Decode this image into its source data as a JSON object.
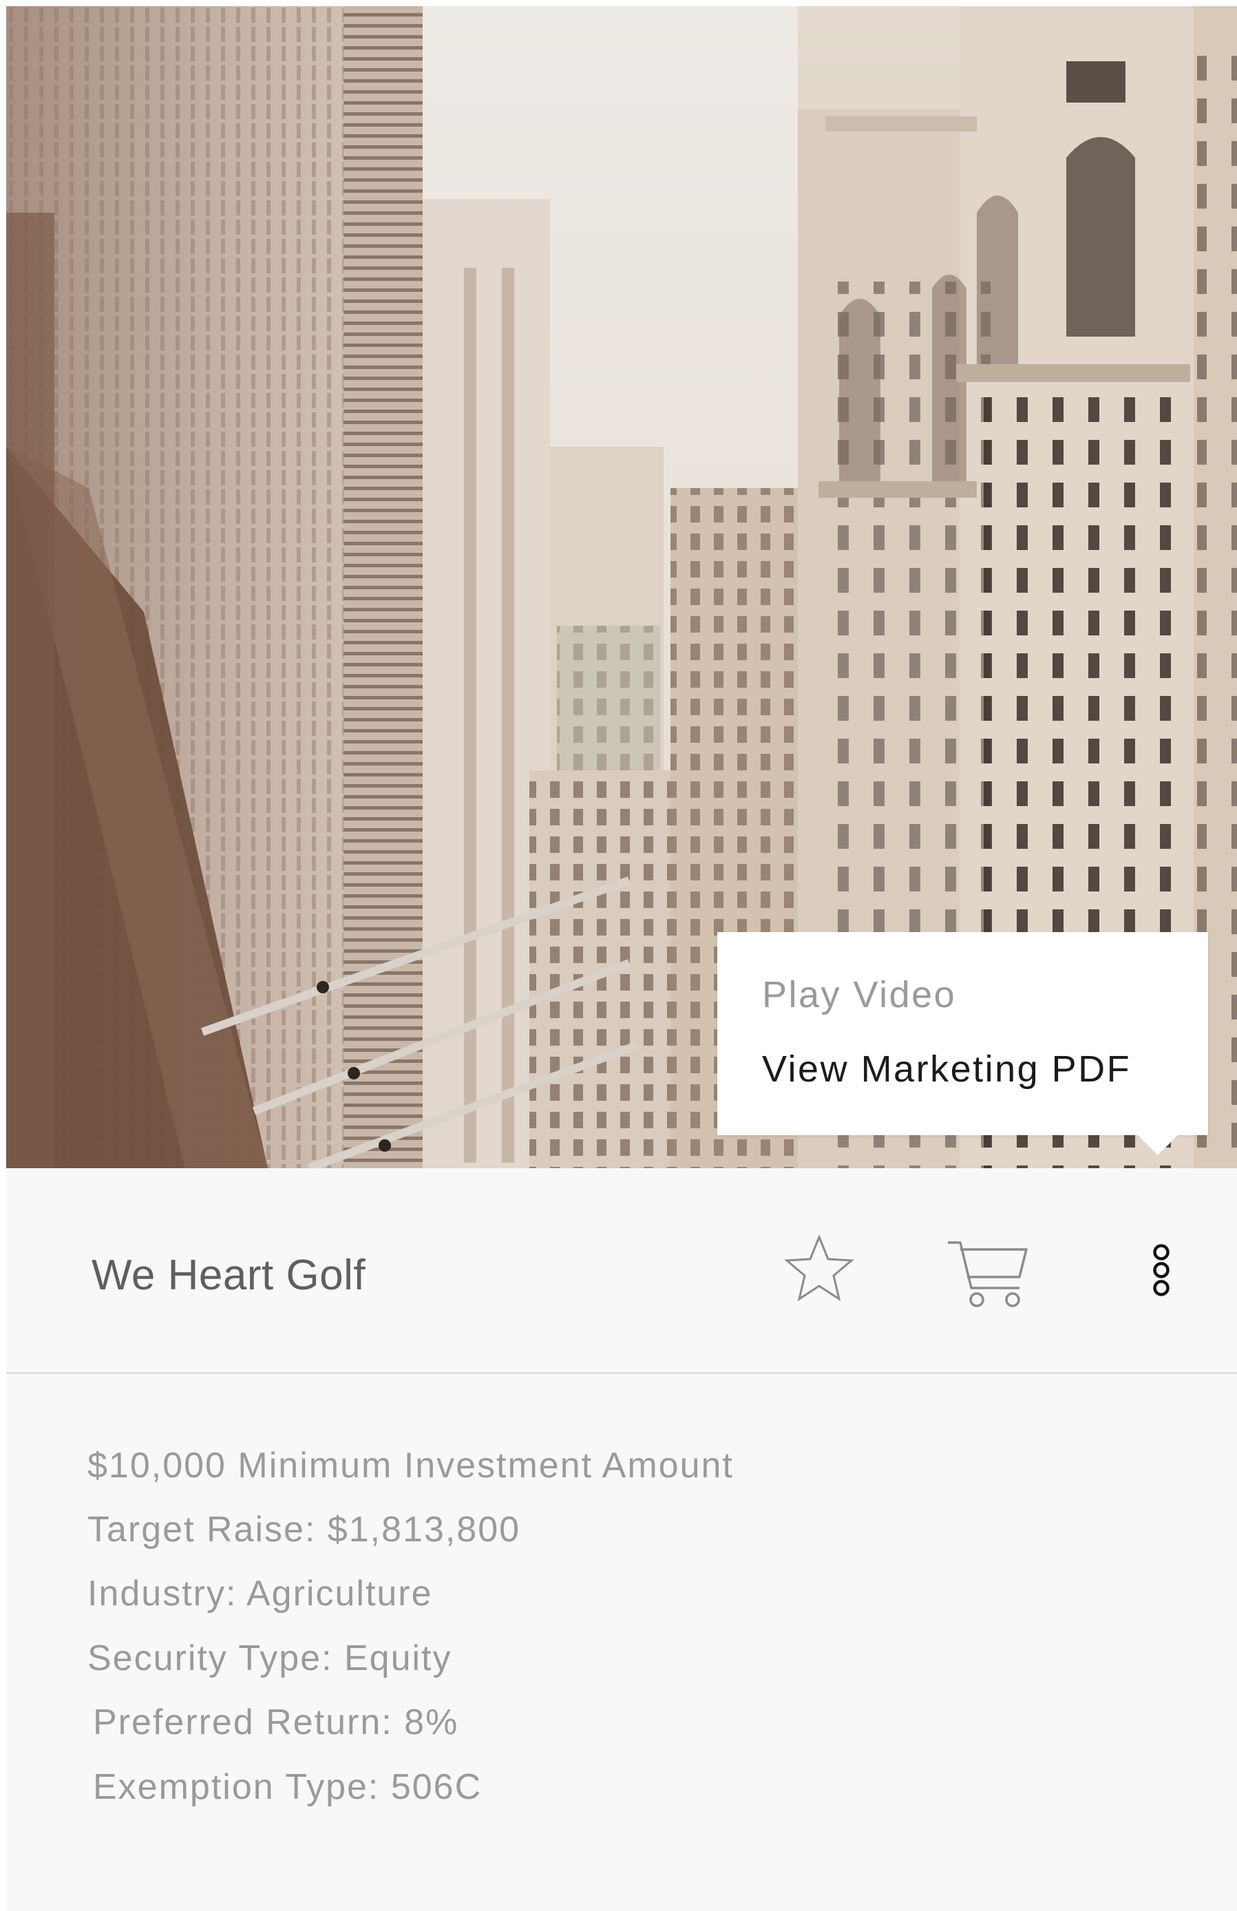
{
  "card": {
    "title": "We Heart Golf",
    "actions": {
      "favorite_icon": "star-outline-icon",
      "cart_icon": "shopping-cart-icon",
      "more_icon": "vertical-dots-icon"
    }
  },
  "menu": {
    "items": [
      {
        "label": "Play Video"
      },
      {
        "label": "View Marketing PDF"
      }
    ]
  },
  "details": [
    "$10,000 Minimum Investment Amount",
    "Target Raise: $1,813,800",
    "Industry: Agriculture",
    "Security Type: Equity",
    "Preferred Return: 8%",
    "Exemption Type: 506C"
  ],
  "colors": {
    "panel_background": "#f8f8f8",
    "title_text": "#5f5f5f",
    "detail_text": "#9a9a9a",
    "menu_text_active": "#1b1b1b",
    "menu_text_muted": "#9a9a9a",
    "divider": "#dedede"
  }
}
